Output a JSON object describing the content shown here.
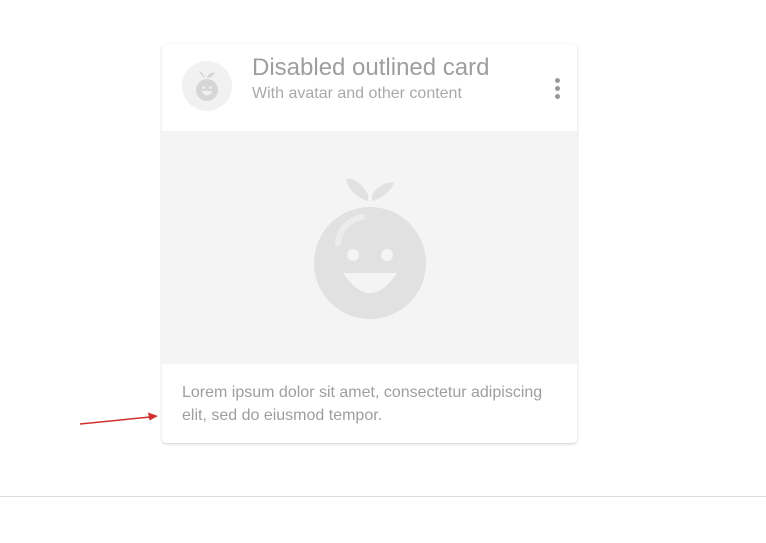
{
  "card": {
    "title": "Disabled outlined card",
    "subtitle": "With avatar and other content",
    "text": "Lorem ipsum dolor sit amet, consectetur adipiscing elit, sed do eiusmod tempor.",
    "state": "disabled"
  },
  "icons": {
    "avatar": "fruit-mascot-icon",
    "menu": "more-vert-icon",
    "media": "fruit-mascot-icon",
    "annotation": "arrow-icon"
  },
  "colors": {
    "annotation_arrow": "#d0312d",
    "disabled_text": "#9e9e9e",
    "media_background": "#f4f4f4"
  }
}
